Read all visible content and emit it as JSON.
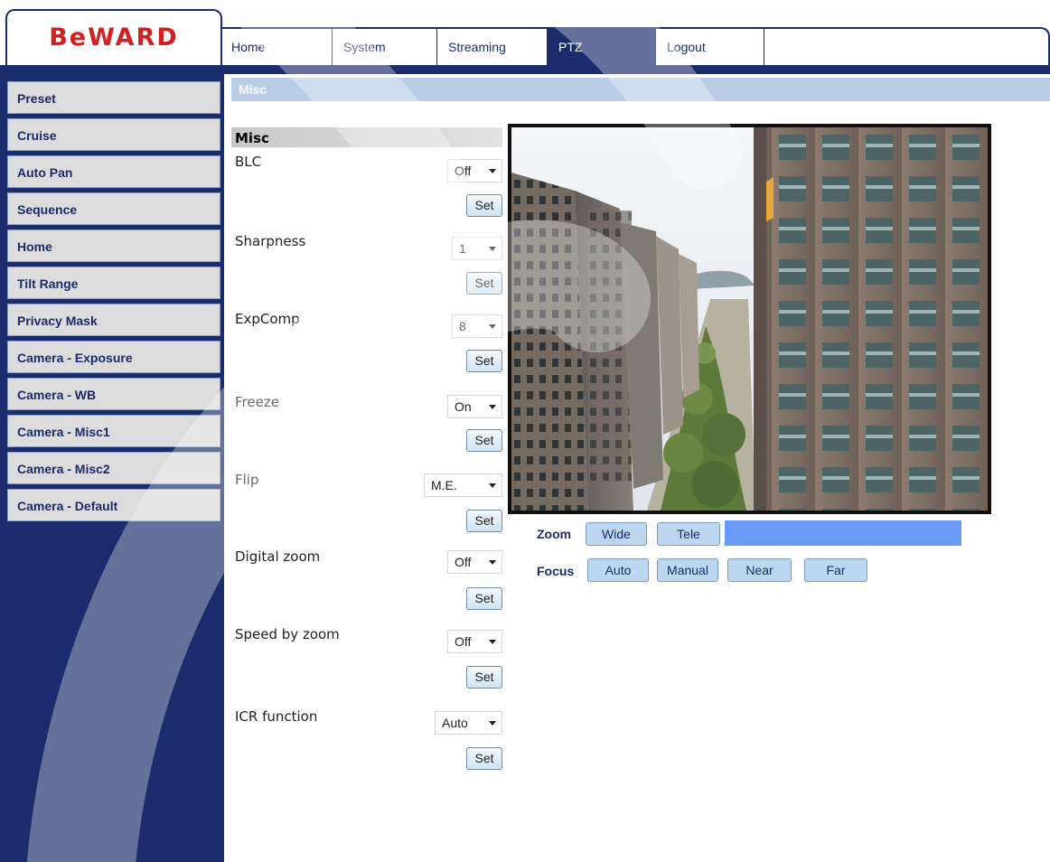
{
  "brand": {
    "logo": "BeWARD"
  },
  "nav": {
    "items": [
      {
        "label": "Home"
      },
      {
        "label": "System"
      },
      {
        "label": "Streaming"
      },
      {
        "label": "PTZ"
      },
      {
        "label": "Logout"
      }
    ],
    "active": "PTZ"
  },
  "sidebar": {
    "items": [
      {
        "label": "Preset"
      },
      {
        "label": "Cruise"
      },
      {
        "label": "Auto Pan"
      },
      {
        "label": "Sequence"
      },
      {
        "label": "Home"
      },
      {
        "label": "Tilt Range"
      },
      {
        "label": "Privacy Mask"
      },
      {
        "label": "Camera - Exposure"
      },
      {
        "label": "Camera - WB"
      },
      {
        "label": "Camera - Misc1"
      },
      {
        "label": "Camera - Misc2"
      },
      {
        "label": "Camera - Default"
      }
    ]
  },
  "page": {
    "section_title": "Misc",
    "group_title": "Misc",
    "set_label": "Set",
    "fields": [
      {
        "label": "BLC",
        "value": "Off"
      },
      {
        "label": "Sharpness",
        "value": "1"
      },
      {
        "label": "ExpComp",
        "value": "8"
      },
      {
        "label": "Freeze",
        "value": "On"
      },
      {
        "label": "Flip",
        "value": "M.E."
      },
      {
        "label": "Digital zoom",
        "value": "Off"
      },
      {
        "label": "Speed by zoom",
        "value": "Off"
      },
      {
        "label": "ICR function",
        "value": "Auto"
      }
    ]
  },
  "ptz": {
    "zoom_label": "Zoom",
    "zoom_buttons": [
      "Wide",
      "Tele"
    ],
    "focus_label": "Focus",
    "focus_buttons": [
      "Auto",
      "Manual",
      "Near",
      "Far"
    ]
  },
  "colors": {
    "navy": "#1a2c6b",
    "logo_red": "#d21f1f",
    "section_bar": "#b9cde6",
    "zoom_indicator": "#6b9af5"
  }
}
